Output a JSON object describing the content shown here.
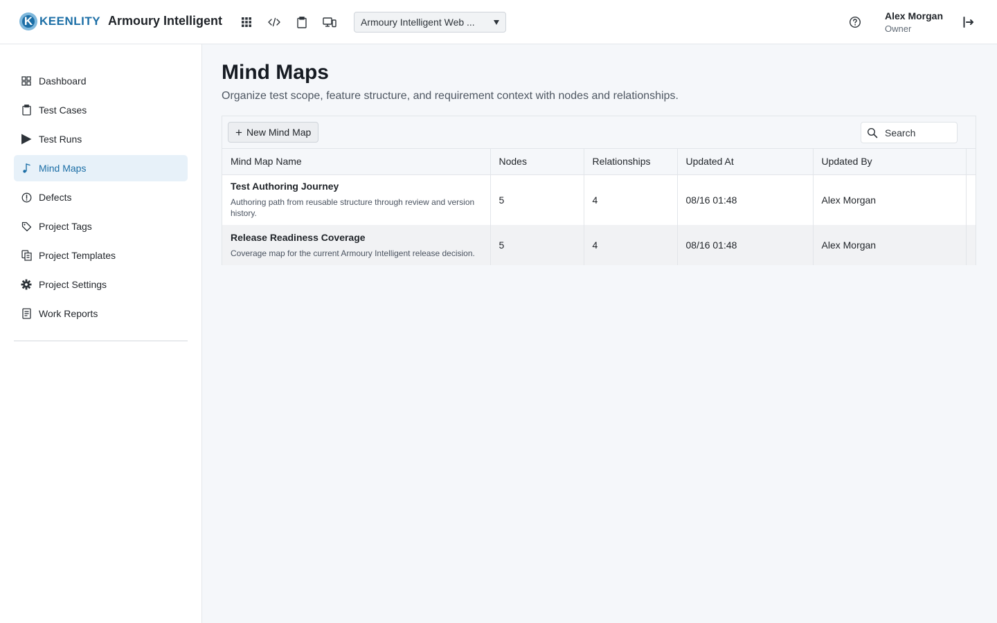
{
  "header": {
    "logo_text": "KEENLITY",
    "logo_letter": "K",
    "app_title": "Armoury Intelligent",
    "project_select": {
      "value": "Armoury Intelligent Web ..."
    },
    "icons": [
      "apps-grid-icon",
      "code-icon",
      "clipboard-icon",
      "devices-icon",
      "help-icon",
      "logout-icon"
    ],
    "user": {
      "name": "Alex Morgan",
      "role": "Owner"
    }
  },
  "sidebar": {
    "items": [
      {
        "label": "Dashboard",
        "icon": "dashboard-icon",
        "active": false
      },
      {
        "label": "Test Cases",
        "icon": "clipboard-icon",
        "active": false
      },
      {
        "label": "Test Runs",
        "icon": "play-icon",
        "active": false
      },
      {
        "label": "Mind Maps",
        "icon": "mind-map-icon",
        "active": true
      },
      {
        "label": "Defects",
        "icon": "alert-circle-icon",
        "active": false
      },
      {
        "label": "Project Tags",
        "icon": "tag-icon",
        "active": false
      },
      {
        "label": "Project Templates",
        "icon": "templates-icon",
        "active": false
      },
      {
        "label": "Project Settings",
        "icon": "gear-icon",
        "active": false
      },
      {
        "label": "Work Reports",
        "icon": "report-icon",
        "active": false
      }
    ]
  },
  "main": {
    "title": "Mind Maps",
    "subtitle": "Organize test scope, feature structure, and requirement context with nodes and relationships.",
    "toolbar": {
      "new_label": "New Mind Map",
      "search_placeholder": "Search"
    },
    "table": {
      "columns": [
        "Mind Map Name",
        "Nodes",
        "Relationships",
        "Updated At",
        "Updated By"
      ],
      "rows": [
        {
          "name": "Test Authoring Journey",
          "description": "Authoring path from reusable structure through review and version history.",
          "nodes": "5",
          "relationships": "4",
          "updated_at": "08/16 01:48",
          "updated_by": "Alex Morgan"
        },
        {
          "name": "Release Readiness Coverage",
          "description": "Coverage map for the current Armoury Intelligent release decision.",
          "nodes": "5",
          "relationships": "4",
          "updated_at": "08/16 01:48",
          "updated_by": "Alex Morgan"
        }
      ]
    }
  },
  "colors": {
    "accent": "#1b6ea6",
    "active_bg": "#e7f1f9",
    "page_bg": "#f5f7fa"
  }
}
